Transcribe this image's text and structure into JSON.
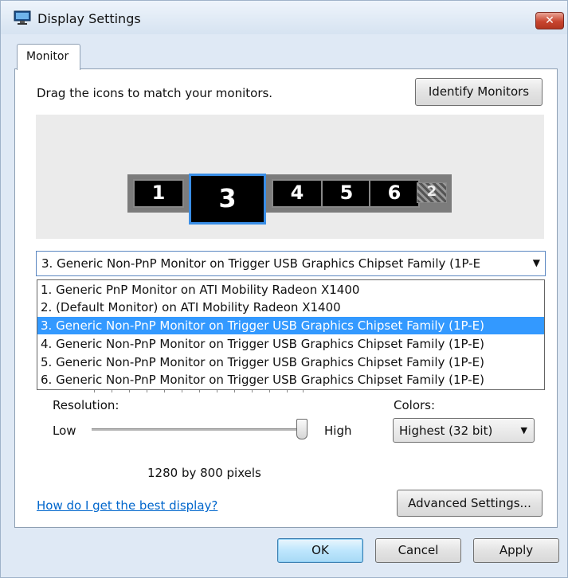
{
  "window": {
    "title": "Display Settings",
    "close_label": "✕"
  },
  "tabs": [
    {
      "label": "Monitor"
    }
  ],
  "instruction": "Drag the icons to match your monitors.",
  "identify_button": "Identify Monitors",
  "monitors": [
    {
      "number": "1"
    },
    {
      "number": "3",
      "selected": true
    },
    {
      "number": "4"
    },
    {
      "number": "5"
    },
    {
      "number": "6"
    },
    {
      "number": "2",
      "disabled": true
    }
  ],
  "monitor_select": {
    "value": "3. Generic Non-PnP Monitor on Trigger USB Graphics Chipset Family (1P-E",
    "options": [
      "1. Generic PnP Monitor on ATI Mobility Radeon X1400",
      "2. (Default Monitor) on ATI Mobility Radeon X1400",
      "3. Generic Non-PnP Monitor on Trigger USB Graphics Chipset Family (1P-E)",
      "4. Generic Non-PnP Monitor on Trigger USB Graphics Chipset Family (1P-E)",
      "5. Generic Non-PnP Monitor on Trigger USB Graphics Chipset Family (1P-E)",
      "6. Generic Non-PnP Monitor on Trigger USB Graphics Chipset Family (1P-E)"
    ],
    "selected_index": 2
  },
  "resolution": {
    "label": "Resolution:",
    "low": "Low",
    "high": "High",
    "value_text": "1280 by 800 pixels",
    "slider_level": 1.0
  },
  "colors": {
    "label": "Colors:",
    "value": "Highest (32 bit)"
  },
  "help_link": "How do I get the best display?",
  "advanced_button": "Advanced Settings...",
  "footer": {
    "ok": "OK",
    "cancel": "Cancel",
    "apply": "Apply"
  },
  "colors_theme": {
    "accent": "#3399ff",
    "link": "#0066cc",
    "selected_monitor_border": "#3a8ee6"
  }
}
